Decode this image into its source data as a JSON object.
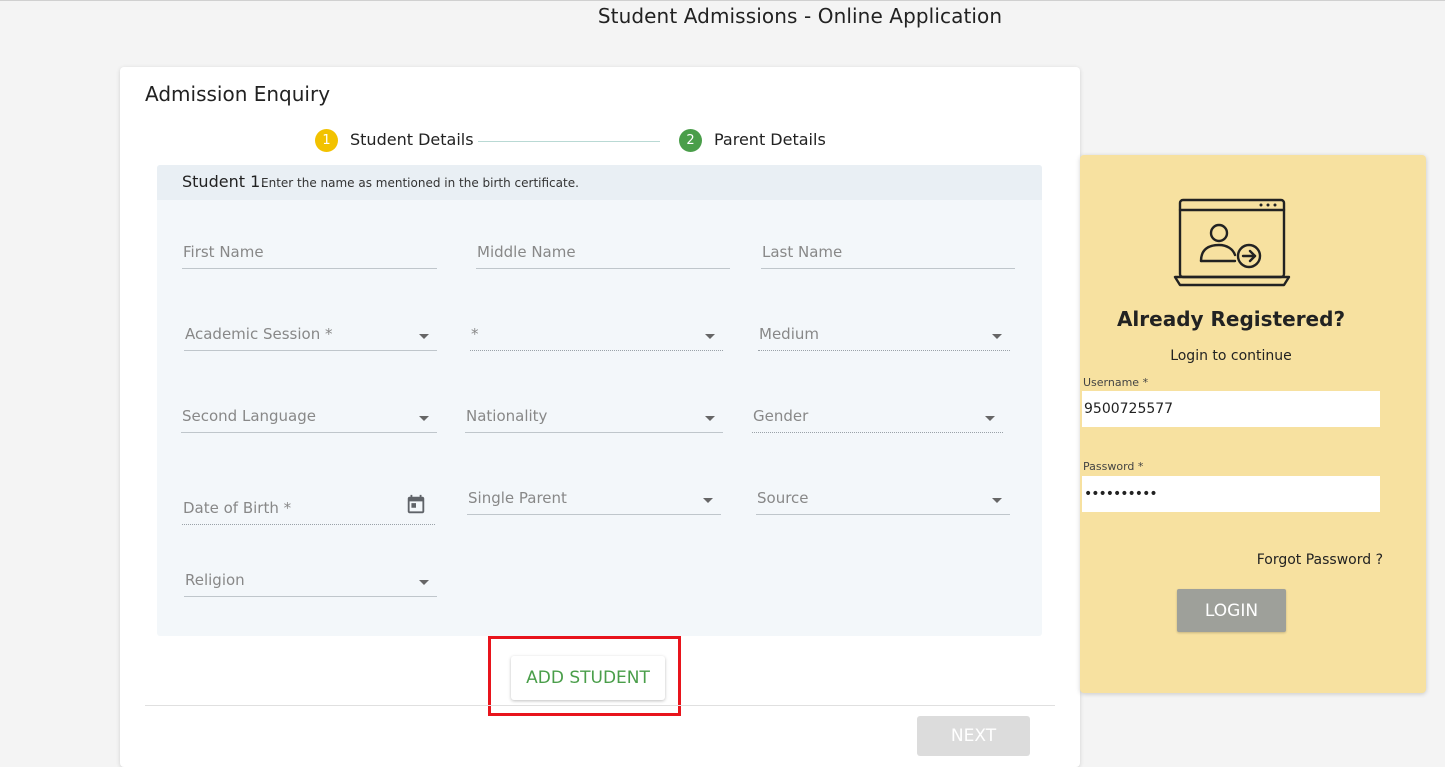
{
  "page": {
    "title": "Student Admissions - Online Application"
  },
  "enquiry": {
    "title": "Admission Enquiry",
    "steps": [
      {
        "number": "1",
        "label": "Student Details",
        "color": "#f2c200"
      },
      {
        "number": "2",
        "label": "Parent Details",
        "color": "#4a9e4a"
      }
    ],
    "student": {
      "heading": "Student 1.",
      "note": "Enter the name as mentioned in the birth certificate."
    },
    "fields": {
      "first_name": "First Name",
      "middle_name": "Middle Name",
      "last_name": "Last Name",
      "academic_session": "Academic Session *",
      "class": "*",
      "medium": "Medium",
      "second_language": "Second Language",
      "nationality": "Nationality",
      "gender": "Gender",
      "date_of_birth": "Date of Birth *",
      "single_parent": "Single Parent",
      "source": "Source",
      "religion": "Religion"
    },
    "add_student_label": "ADD STUDENT",
    "next_label": "NEXT"
  },
  "login": {
    "title": "Already Registered?",
    "subtitle": "Login to continue",
    "username_label": "Username *",
    "username_value": "9500725577",
    "password_label": "Password *",
    "password_value": "••••••••••",
    "forgot_label": "Forgot Password ?",
    "login_label": "LOGIN"
  }
}
